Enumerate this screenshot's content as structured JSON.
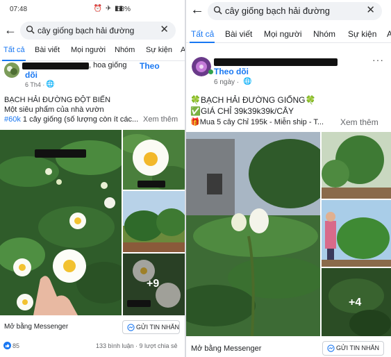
{
  "left": {
    "status": {
      "time": "07:48",
      "battery": "58%"
    },
    "search": {
      "query": "cây giống bạch hải đường"
    },
    "tabs": [
      "Tất cả",
      "Bài viết",
      "Mọi người",
      "Nhóm",
      "Sự kiện",
      "A"
    ],
    "post": {
      "author_visible": ", hoa giống",
      "follow": "Theo",
      "follow2": "dõi",
      "time": "6 Th4 ·",
      "line1": "BẠCH HẢI ĐƯỜNG ĐỘT BIẾN",
      "line2": "Một siêu phẩm của nhà vườn",
      "hashtag": "#60k",
      "line3": " 1 cây giống (số lượng còn ít các...",
      "see_more": "Xem thêm",
      "more_images": "+9",
      "messenger_label": "Mở bằng Messenger",
      "send_button": "GỬI TIN NHẮN",
      "reactions": "85",
      "comments_shares": "133 bình luận · 9 lượt chia sẻ"
    }
  },
  "right": {
    "search": {
      "query": "cây giống bạch hải đường"
    },
    "tabs": [
      "Tất cả",
      "Bài viết",
      "Mọi người",
      "Nhóm",
      "Sự kiện",
      "A"
    ],
    "post": {
      "follow": "Theo dõi",
      "time": "6 ngày ·",
      "line1": "🍀BẠCH HẢI ĐƯỜNG GIỐNG🍀",
      "line2": "✅GIÁ CHỈ 39k39k39k/CÂY",
      "line3": "🎁Mua 5 cây Chỉ 195k - Miễn ship - T...",
      "see_more": "Xem thêm",
      "more_images": "+4",
      "messenger_label": "Mở bằng Messenger",
      "send_button": "GỬI TIN NHẮN"
    }
  },
  "colors": {
    "accent": "#1877f2",
    "secondary_text": "#65676b"
  }
}
